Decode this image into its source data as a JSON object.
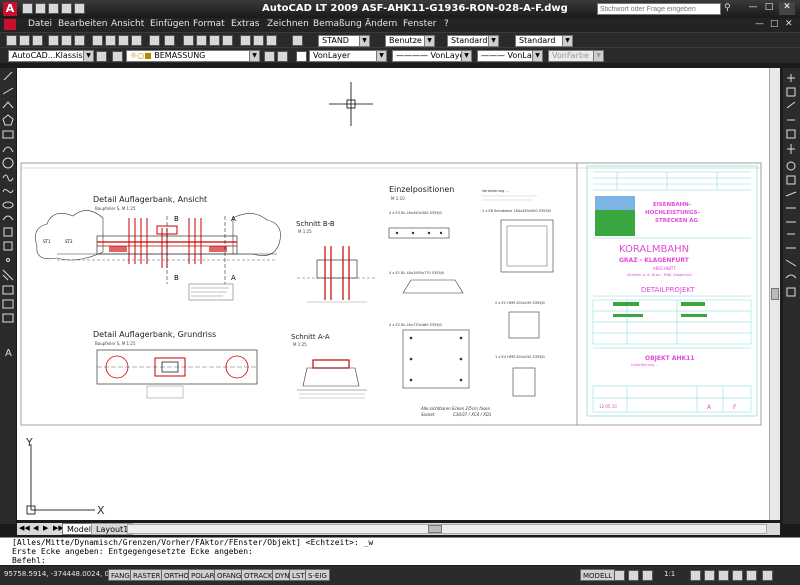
{
  "window": {
    "title": "AutoCAD LT 2009  ASF-AHK11-G1936-RON-028-A-F.dwg",
    "help_search_placeholder": "Stichwort oder Frage eingeben"
  },
  "menu": [
    "Datei",
    "Bearbeiten",
    "Ansicht",
    "Einfügen",
    "Format",
    "Extras",
    "Zeichnen",
    "Bemaßung",
    "Ändern",
    "Fenster",
    "?"
  ],
  "toolbar": {
    "workspace": "AutoCAD...Klassisch",
    "layer": "BEMASSUNG",
    "textstyle": "STAND",
    "dimstyle": "Benutze",
    "tablestyle": "Standard",
    "mleaderstyle": "Standard",
    "color": "VonLayer",
    "linetype": "VonLayer",
    "lineweight": "VonLayer",
    "plotstyle": "VonFarbe"
  },
  "drawing": {
    "views": {
      "ansicht_title": "Detail Auflagerbank, Ansicht",
      "ansicht_sub": "Baupfeiler S, M 1:25",
      "grundriss_title": "Detail Auflagerbank, Grundriss",
      "grundriss_sub": "Baupfeiler S, M 1:25",
      "schnitt_bb": "Schnitt B-B",
      "schnitt_bb_sub": "M 1:25",
      "schnitt_aa": "Schnitt A-A",
      "schnitt_aa_sub": "M 1:25",
      "einzel_title": "Einzelpositionen",
      "einzel_sub": "M 1:10",
      "note_dims": "Alle sichtbaren Ecken 2/5cm fasen",
      "note_sockel": "Sockel:",
      "note_sockel_val": "C30/37 / XC4 / XD1",
      "label_b": "B",
      "label_a": "A",
      "st1": "ST1",
      "st2": "ST2",
      "pos1": "1 x E6 Schablone 184x450x500 S355J0",
      "pos2": "2 x E1 HEM 200x190 S355J0",
      "pos3": "1 x E4 HEM 200x150 S355J0",
      "pos4": "4 x E3 BL 40x450x300 S355J0",
      "pos5": "4 x E1 BL 40x1950x770 S355J0",
      "pos6": "4 x E2 BL 40x770x460 S355J0",
      "hinweis": "Verankerung ..."
    },
    "titleblock": {
      "company_line1": "EISENBAHN-",
      "company_line2": "HOCHLEISTUNGS-",
      "company_line3": "STRECKEN AG",
      "project": "KORALMBAHN",
      "route": "GRAZ - KLAGENFURT",
      "section_label": "ABSCHNITT",
      "section": "Althofen a. d. Drau - Mittl. Klagenfurt",
      "plan_type": "DETAILPROJEKT",
      "object": "OBJEKT AHK11",
      "object_sub": "Unterführung ...",
      "date": "12.05.10",
      "rev_a": "A",
      "rev_f": "F"
    }
  },
  "tabs": {
    "model": "Model",
    "layout1": "Layout1"
  },
  "command": {
    "line1": "[Alles/Mitte/Dynamisch/Grenzen/Vorher/FAktor/FEnster/Objekt] <Echtzeit>: _w",
    "line2": "Erste Ecke angeben: Entgegengesetzte Ecke angeben:",
    "prompt": "Befehl:"
  },
  "status": {
    "coords": "95758.5914, -374448.0024, 0.0000",
    "buttons": [
      "FANG",
      "RASTER",
      "ORTHO",
      "POLAR",
      "OFANG",
      "OTRACK",
      "DYN",
      "LST",
      "S-EIG"
    ],
    "model": "MODELL",
    "scale": "1:1"
  },
  "ucs": {
    "y": "Y",
    "x": "X"
  }
}
